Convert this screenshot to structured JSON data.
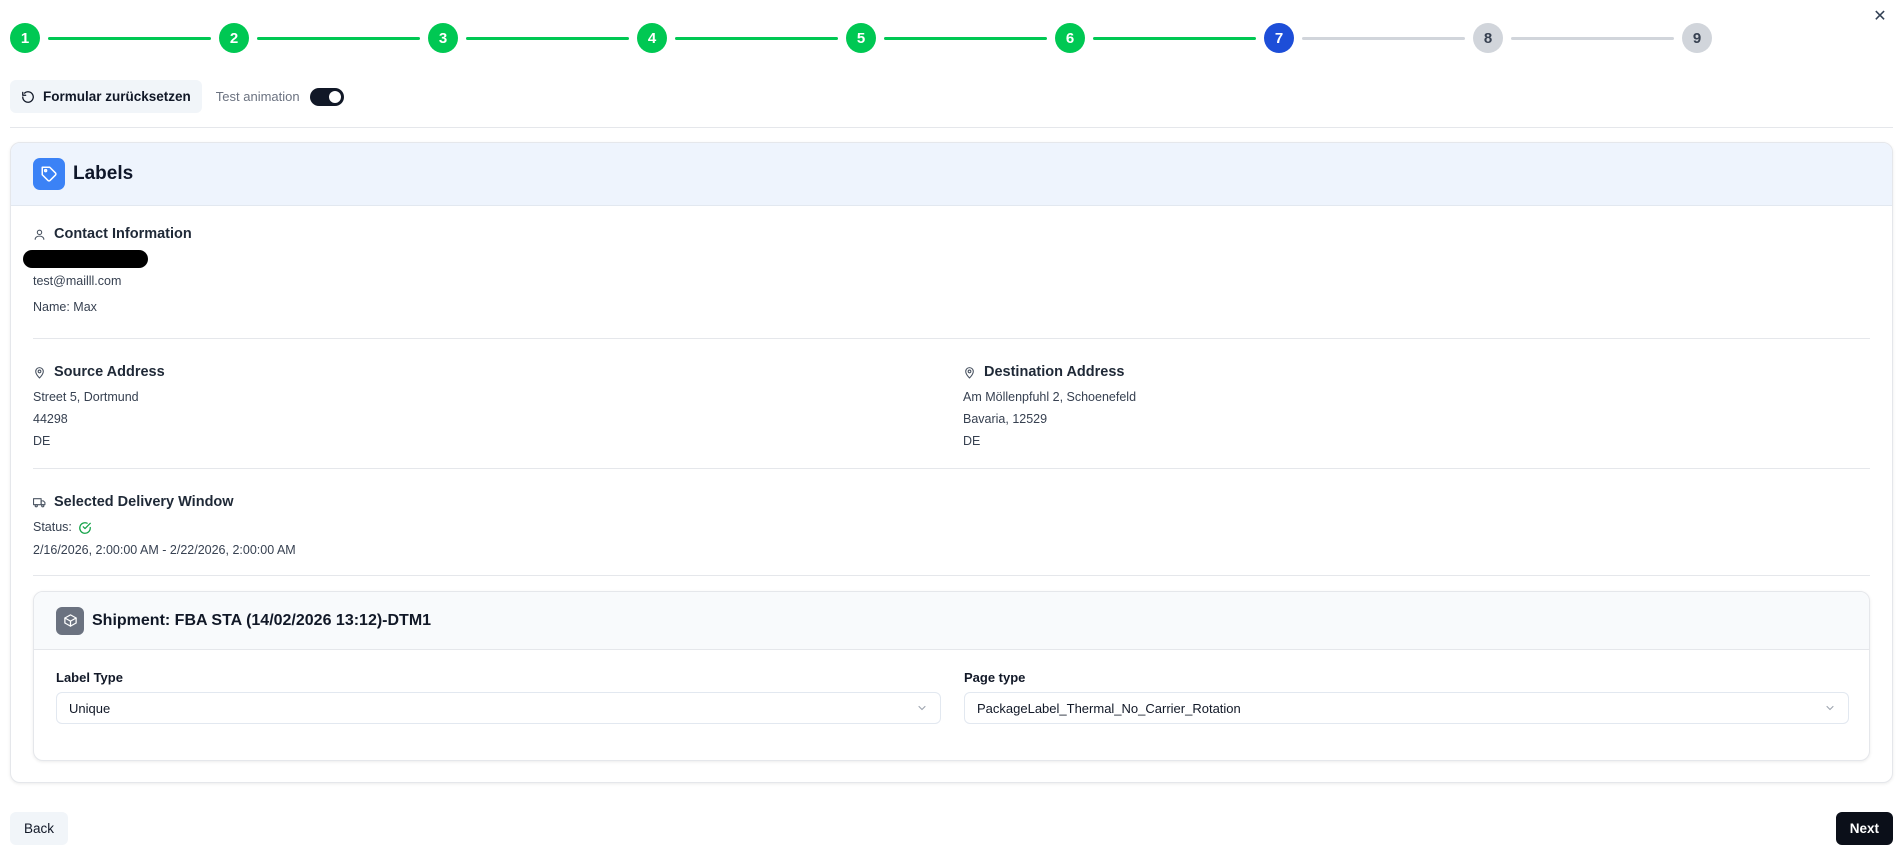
{
  "stepper": {
    "steps": [
      {
        "label": "1",
        "state": "done"
      },
      {
        "label": "2",
        "state": "done"
      },
      {
        "label": "3",
        "state": "done"
      },
      {
        "label": "4",
        "state": "done"
      },
      {
        "label": "5",
        "state": "done"
      },
      {
        "label": "6",
        "state": "done"
      },
      {
        "label": "7",
        "state": "current"
      },
      {
        "label": "8",
        "state": "todo"
      },
      {
        "label": "9",
        "state": "todo"
      }
    ]
  },
  "close_icon": "close-icon",
  "toolbar": {
    "reset_label": "Formular zurücksetzen",
    "toggle_label": "Test animation",
    "toggle_on": true
  },
  "card": {
    "title": "Labels",
    "icon": "tag-icon",
    "contact": {
      "heading": "Contact Information",
      "email": "test@mailll.com",
      "name": "Name: Max"
    },
    "source": {
      "heading": "Source Address",
      "line1": "Street 5, Dortmund",
      "line2": "44298",
      "line3": "DE"
    },
    "destination": {
      "heading": "Destination Address",
      "line1": "Am Möllenpfuhl 2, Schoenefeld",
      "line2": "Bavaria, 12529",
      "line3": "DE"
    },
    "delivery": {
      "heading": "Selected Delivery Window",
      "status_label": "Status:",
      "window": "2/16/2026, 2:00:00 AM - 2/22/2026, 2:00:00 AM"
    },
    "shipment": {
      "title": "Shipment: FBA STA (14/02/2026 13:12)-DTM1",
      "label_type": {
        "label": "Label Type",
        "value": "Unique"
      },
      "page_type": {
        "label": "Page type",
        "value": "PackageLabel_Thermal_No_Carrier_Rotation"
      }
    }
  },
  "footer": {
    "back_label": "Back",
    "next_label": "Next"
  },
  "colors": {
    "done": "#00c853",
    "current": "#1d4ed8",
    "todo": "#d1d5db",
    "accent": "#3b82f6"
  }
}
